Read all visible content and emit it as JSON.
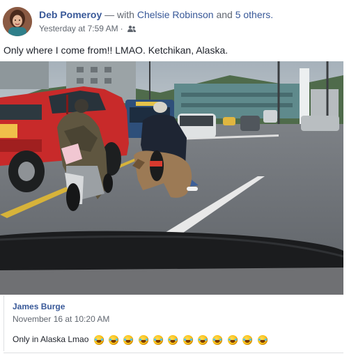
{
  "post": {
    "author": "Deb Pomeroy",
    "with_prefix": "— with",
    "tagged_person": "Chelsie Robinson",
    "and_text": "and",
    "others_count": "5 others.",
    "timestamp": "Yesterday at 7:59 AM",
    "audience_icon": "friends-icon",
    "text": "Only where I come from!! LMAO. Ketchikan, Alaska."
  },
  "comment": {
    "author": "James Burge",
    "timestamp": "November 16 at 10:20 AM",
    "text": "Only in Alaska Lmao",
    "emoji_name": "rolling-on-the-floor-laughing-emoji",
    "emoji_count": 12
  },
  "colors": {
    "link": "#385898",
    "meta": "#616770",
    "text": "#1d2129"
  }
}
